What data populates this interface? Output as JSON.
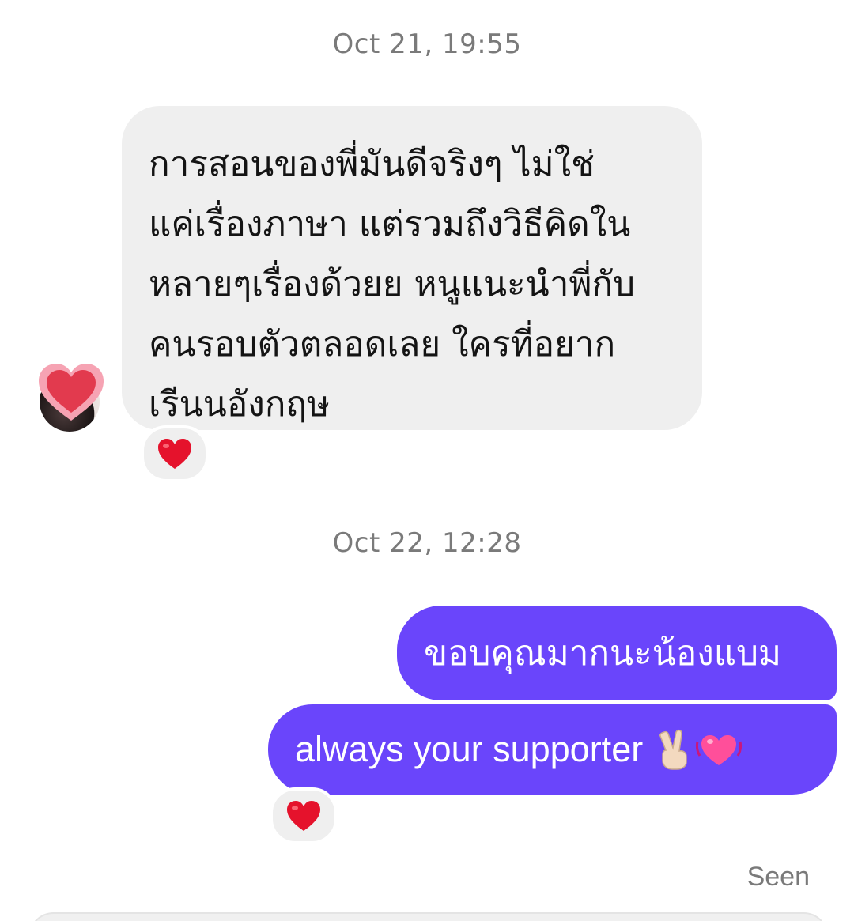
{
  "thread": {
    "timestamp_1": "Oct 21, 19:55",
    "incoming_message": {
      "lines": [
        "การสอนของพี่มันดีจริงๆ ไม่ใช่",
        "แค่เรื่องภาษา แต่รวมถึงวิธีคิดใน",
        "หลายๆเรื่องด้วยย หนูแนะนำพี่กับ",
        "คนรอบตัวตลอดเลย ใครที่อยาก",
        "เรีนนอังกฤษ"
      ],
      "reaction_icon": "red-heart-icon"
    },
    "timestamp_2": "Oct 22, 12:28",
    "outgoing_messages": [
      {
        "text": "ขอบคุณมากนะน้องแบม"
      },
      {
        "text": "always your supporter",
        "emoji": [
          "victory-hand-icon",
          "beating-heart-icon"
        ]
      }
    ],
    "outgoing_reaction_icon": "red-heart-icon",
    "status": "Seen"
  },
  "colors": {
    "outgoing_bubble": "#6a45fb",
    "incoming_bubble": "#efefef",
    "timestamp_text": "#7a7a7a",
    "reaction_heart": "#e5122c"
  }
}
